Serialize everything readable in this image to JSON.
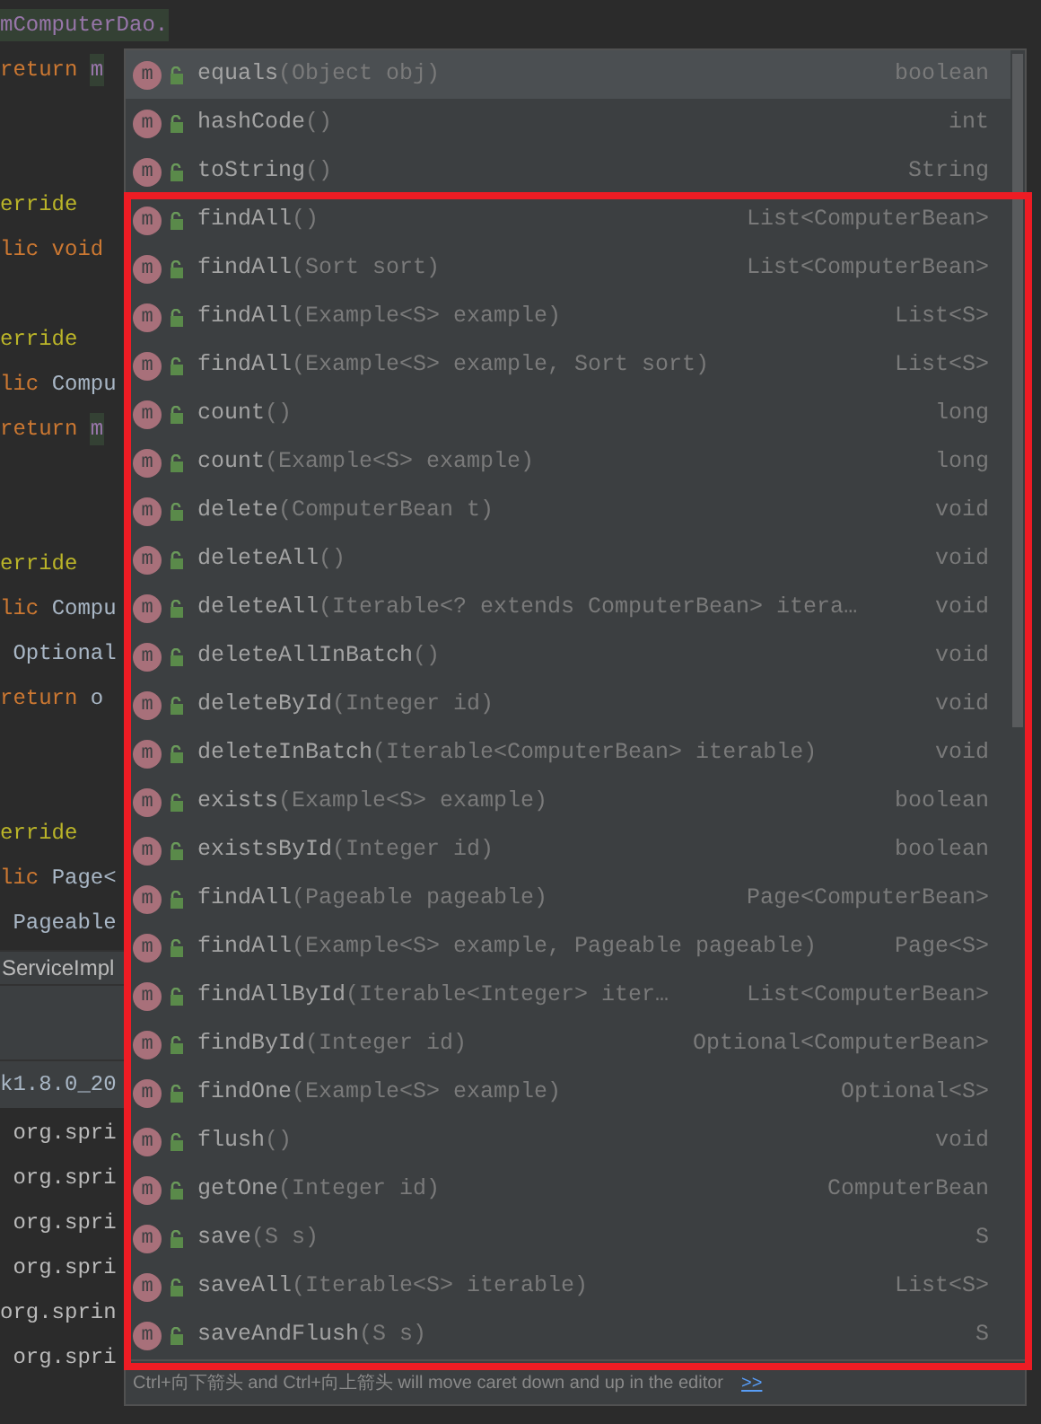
{
  "editor": {
    "lines": [
      {
        "segments": [
          {
            "text": "mComputerDao.",
            "kind": "field",
            "highlight": true
          }
        ]
      },
      {
        "segments": [
          {
            "text": "return ",
            "kind": "keyword"
          },
          {
            "text": "m",
            "kind": "field",
            "highlight": true
          }
        ]
      },
      {
        "blank_above": true,
        "second_blank_above": true,
        "segments": [
          {
            "text": "erride",
            "kind": "annotation"
          }
        ]
      },
      {
        "segments": [
          {
            "text": "lic void",
            "kind": "keyword"
          }
        ]
      },
      {
        "blank_above": true,
        "segments": [
          {
            "text": "erride",
            "kind": "annotation"
          }
        ]
      },
      {
        "segments": [
          {
            "text": "lic ",
            "kind": "keyword"
          },
          {
            "text": "Compu",
            "kind": "plain"
          }
        ]
      },
      {
        "segments": [
          {
            "text": "return ",
            "kind": "keyword"
          },
          {
            "text": "m",
            "kind": "field",
            "highlight": true
          }
        ]
      },
      {
        "blank_above": true,
        "second_blank_above": true,
        "segments": [
          {
            "text": "erride",
            "kind": "annotation"
          }
        ]
      },
      {
        "segments": [
          {
            "text": "lic ",
            "kind": "keyword"
          },
          {
            "text": "Compu",
            "kind": "plain"
          }
        ]
      },
      {
        "segments": [
          {
            "text": " Optional",
            "kind": "plain"
          }
        ]
      },
      {
        "segments": [
          {
            "text": "return ",
            "kind": "keyword"
          },
          {
            "text": "o",
            "kind": "plain"
          }
        ]
      },
      {
        "blank_above": true,
        "second_blank_above": true,
        "segments": [
          {
            "text": "erride",
            "kind": "annotation"
          }
        ]
      },
      {
        "segments": [
          {
            "text": "lic ",
            "kind": "keyword"
          },
          {
            "text": "Page<",
            "kind": "plain"
          }
        ]
      },
      {
        "segments": [
          {
            "text": " Pageable",
            "kind": "plain"
          }
        ]
      }
    ]
  },
  "tab": {
    "label": "ServiceImpl"
  },
  "console": {
    "header": "k1.8.0_20",
    "lines": [
      " org.spri",
      " org.spri",
      " org.spri",
      " org.spri",
      "org.sprin",
      " org.spri"
    ]
  },
  "completion": {
    "items": [
      {
        "badge": "m",
        "name": "equals",
        "params": "(Object obj)",
        "type": "boolean",
        "selected": true
      },
      {
        "badge": "m",
        "name": "hashCode",
        "params": "()",
        "type": "int",
        "selected": false
      },
      {
        "badge": "m",
        "name": "toString",
        "params": "()",
        "type": "String",
        "selected": false
      },
      {
        "badge": "m",
        "name": "findAll",
        "params": "()",
        "type": "List<ComputerBean>",
        "selected": false
      },
      {
        "badge": "m",
        "name": "findAll",
        "params": "(Sort sort)",
        "type": "List<ComputerBean>",
        "selected": false
      },
      {
        "badge": "m",
        "name": "findAll",
        "params": "(Example<S> example)",
        "type": "List<S>",
        "selected": false
      },
      {
        "badge": "m",
        "name": "findAll",
        "params": "(Example<S> example, Sort sort)",
        "type": "List<S>",
        "selected": false
      },
      {
        "badge": "m",
        "name": "count",
        "params": "()",
        "type": "long",
        "selected": false
      },
      {
        "badge": "m",
        "name": "count",
        "params": "(Example<S> example)",
        "type": "long",
        "selected": false
      },
      {
        "badge": "m",
        "name": "delete",
        "params": "(ComputerBean t)",
        "type": "void",
        "selected": false
      },
      {
        "badge": "m",
        "name": "deleteAll",
        "params": "()",
        "type": "void",
        "selected": false
      },
      {
        "badge": "m",
        "name": "deleteAll",
        "params": "(Iterable<? extends ComputerBean> itera…",
        "type": "void",
        "selected": false
      },
      {
        "badge": "m",
        "name": "deleteAllInBatch",
        "params": "()",
        "type": "void",
        "selected": false
      },
      {
        "badge": "m",
        "name": "deleteById",
        "params": "(Integer id)",
        "type": "void",
        "selected": false
      },
      {
        "badge": "m",
        "name": "deleteInBatch",
        "params": "(Iterable<ComputerBean> iterable)",
        "type": "void",
        "selected": false
      },
      {
        "badge": "m",
        "name": "exists",
        "params": "(Example<S> example)",
        "type": "boolean",
        "selected": false
      },
      {
        "badge": "m",
        "name": "existsById",
        "params": "(Integer id)",
        "type": "boolean",
        "selected": false
      },
      {
        "badge": "m",
        "name": "findAll",
        "params": "(Pageable pageable)",
        "type": "Page<ComputerBean>",
        "selected": false
      },
      {
        "badge": "m",
        "name": "findAll",
        "params": "(Example<S> example, Pageable pageable)",
        "type": "Page<S>",
        "selected": false
      },
      {
        "badge": "m",
        "name": "findAllById",
        "params": "(Iterable<Integer> iter…",
        "type": "List<ComputerBean>",
        "selected": false
      },
      {
        "badge": "m",
        "name": "findById",
        "params": "(Integer id)",
        "type": "Optional<ComputerBean>",
        "selected": false
      },
      {
        "badge": "m",
        "name": "findOne",
        "params": "(Example<S> example)",
        "type": "Optional<S>",
        "selected": false
      },
      {
        "badge": "m",
        "name": "flush",
        "params": "()",
        "type": "void",
        "selected": false
      },
      {
        "badge": "m",
        "name": "getOne",
        "params": "(Integer id)",
        "type": "ComputerBean",
        "selected": false
      },
      {
        "badge": "m",
        "name": "save",
        "params": "(S s)",
        "type": "S",
        "selected": false
      },
      {
        "badge": "m",
        "name": "saveAll",
        "params": "(Iterable<S> iterable)",
        "type": "List<S>",
        "selected": false
      },
      {
        "badge": "m",
        "name": "saveAndFlush",
        "params": "(S s)",
        "type": "S",
        "selected": false
      }
    ],
    "hint": "Ctrl+向下箭头 and Ctrl+向上箭头 will move caret down and up in the editor",
    "hint_link": ">>"
  }
}
